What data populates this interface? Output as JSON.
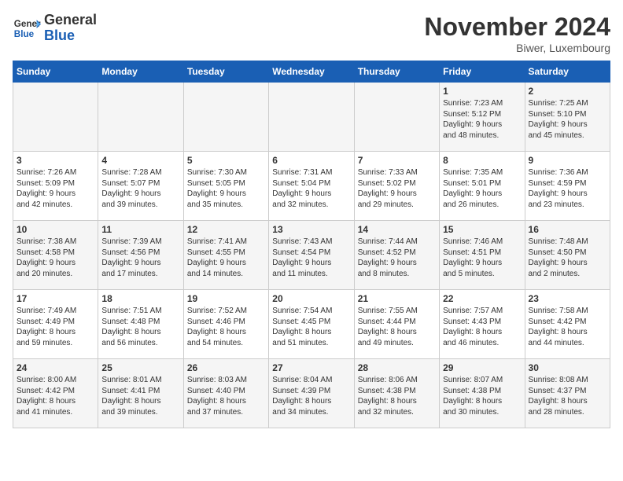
{
  "header": {
    "logo_line1": "General",
    "logo_line2": "Blue",
    "month_title": "November 2024",
    "location": "Biwer, Luxembourg"
  },
  "weekdays": [
    "Sunday",
    "Monday",
    "Tuesday",
    "Wednesday",
    "Thursday",
    "Friday",
    "Saturday"
  ],
  "weeks": [
    [
      {
        "day": "",
        "info": ""
      },
      {
        "day": "",
        "info": ""
      },
      {
        "day": "",
        "info": ""
      },
      {
        "day": "",
        "info": ""
      },
      {
        "day": "",
        "info": ""
      },
      {
        "day": "1",
        "info": "Sunrise: 7:23 AM\nSunset: 5:12 PM\nDaylight: 9 hours\nand 48 minutes."
      },
      {
        "day": "2",
        "info": "Sunrise: 7:25 AM\nSunset: 5:10 PM\nDaylight: 9 hours\nand 45 minutes."
      }
    ],
    [
      {
        "day": "3",
        "info": "Sunrise: 7:26 AM\nSunset: 5:09 PM\nDaylight: 9 hours\nand 42 minutes."
      },
      {
        "day": "4",
        "info": "Sunrise: 7:28 AM\nSunset: 5:07 PM\nDaylight: 9 hours\nand 39 minutes."
      },
      {
        "day": "5",
        "info": "Sunrise: 7:30 AM\nSunset: 5:05 PM\nDaylight: 9 hours\nand 35 minutes."
      },
      {
        "day": "6",
        "info": "Sunrise: 7:31 AM\nSunset: 5:04 PM\nDaylight: 9 hours\nand 32 minutes."
      },
      {
        "day": "7",
        "info": "Sunrise: 7:33 AM\nSunset: 5:02 PM\nDaylight: 9 hours\nand 29 minutes."
      },
      {
        "day": "8",
        "info": "Sunrise: 7:35 AM\nSunset: 5:01 PM\nDaylight: 9 hours\nand 26 minutes."
      },
      {
        "day": "9",
        "info": "Sunrise: 7:36 AM\nSunset: 4:59 PM\nDaylight: 9 hours\nand 23 minutes."
      }
    ],
    [
      {
        "day": "10",
        "info": "Sunrise: 7:38 AM\nSunset: 4:58 PM\nDaylight: 9 hours\nand 20 minutes."
      },
      {
        "day": "11",
        "info": "Sunrise: 7:39 AM\nSunset: 4:56 PM\nDaylight: 9 hours\nand 17 minutes."
      },
      {
        "day": "12",
        "info": "Sunrise: 7:41 AM\nSunset: 4:55 PM\nDaylight: 9 hours\nand 14 minutes."
      },
      {
        "day": "13",
        "info": "Sunrise: 7:43 AM\nSunset: 4:54 PM\nDaylight: 9 hours\nand 11 minutes."
      },
      {
        "day": "14",
        "info": "Sunrise: 7:44 AM\nSunset: 4:52 PM\nDaylight: 9 hours\nand 8 minutes."
      },
      {
        "day": "15",
        "info": "Sunrise: 7:46 AM\nSunset: 4:51 PM\nDaylight: 9 hours\nand 5 minutes."
      },
      {
        "day": "16",
        "info": "Sunrise: 7:48 AM\nSunset: 4:50 PM\nDaylight: 9 hours\nand 2 minutes."
      }
    ],
    [
      {
        "day": "17",
        "info": "Sunrise: 7:49 AM\nSunset: 4:49 PM\nDaylight: 8 hours\nand 59 minutes."
      },
      {
        "day": "18",
        "info": "Sunrise: 7:51 AM\nSunset: 4:48 PM\nDaylight: 8 hours\nand 56 minutes."
      },
      {
        "day": "19",
        "info": "Sunrise: 7:52 AM\nSunset: 4:46 PM\nDaylight: 8 hours\nand 54 minutes."
      },
      {
        "day": "20",
        "info": "Sunrise: 7:54 AM\nSunset: 4:45 PM\nDaylight: 8 hours\nand 51 minutes."
      },
      {
        "day": "21",
        "info": "Sunrise: 7:55 AM\nSunset: 4:44 PM\nDaylight: 8 hours\nand 49 minutes."
      },
      {
        "day": "22",
        "info": "Sunrise: 7:57 AM\nSunset: 4:43 PM\nDaylight: 8 hours\nand 46 minutes."
      },
      {
        "day": "23",
        "info": "Sunrise: 7:58 AM\nSunset: 4:42 PM\nDaylight: 8 hours\nand 44 minutes."
      }
    ],
    [
      {
        "day": "24",
        "info": "Sunrise: 8:00 AM\nSunset: 4:42 PM\nDaylight: 8 hours\nand 41 minutes."
      },
      {
        "day": "25",
        "info": "Sunrise: 8:01 AM\nSunset: 4:41 PM\nDaylight: 8 hours\nand 39 minutes."
      },
      {
        "day": "26",
        "info": "Sunrise: 8:03 AM\nSunset: 4:40 PM\nDaylight: 8 hours\nand 37 minutes."
      },
      {
        "day": "27",
        "info": "Sunrise: 8:04 AM\nSunset: 4:39 PM\nDaylight: 8 hours\nand 34 minutes."
      },
      {
        "day": "28",
        "info": "Sunrise: 8:06 AM\nSunset: 4:38 PM\nDaylight: 8 hours\nand 32 minutes."
      },
      {
        "day": "29",
        "info": "Sunrise: 8:07 AM\nSunset: 4:38 PM\nDaylight: 8 hours\nand 30 minutes."
      },
      {
        "day": "30",
        "info": "Sunrise: 8:08 AM\nSunset: 4:37 PM\nDaylight: 8 hours\nand 28 minutes."
      }
    ]
  ]
}
